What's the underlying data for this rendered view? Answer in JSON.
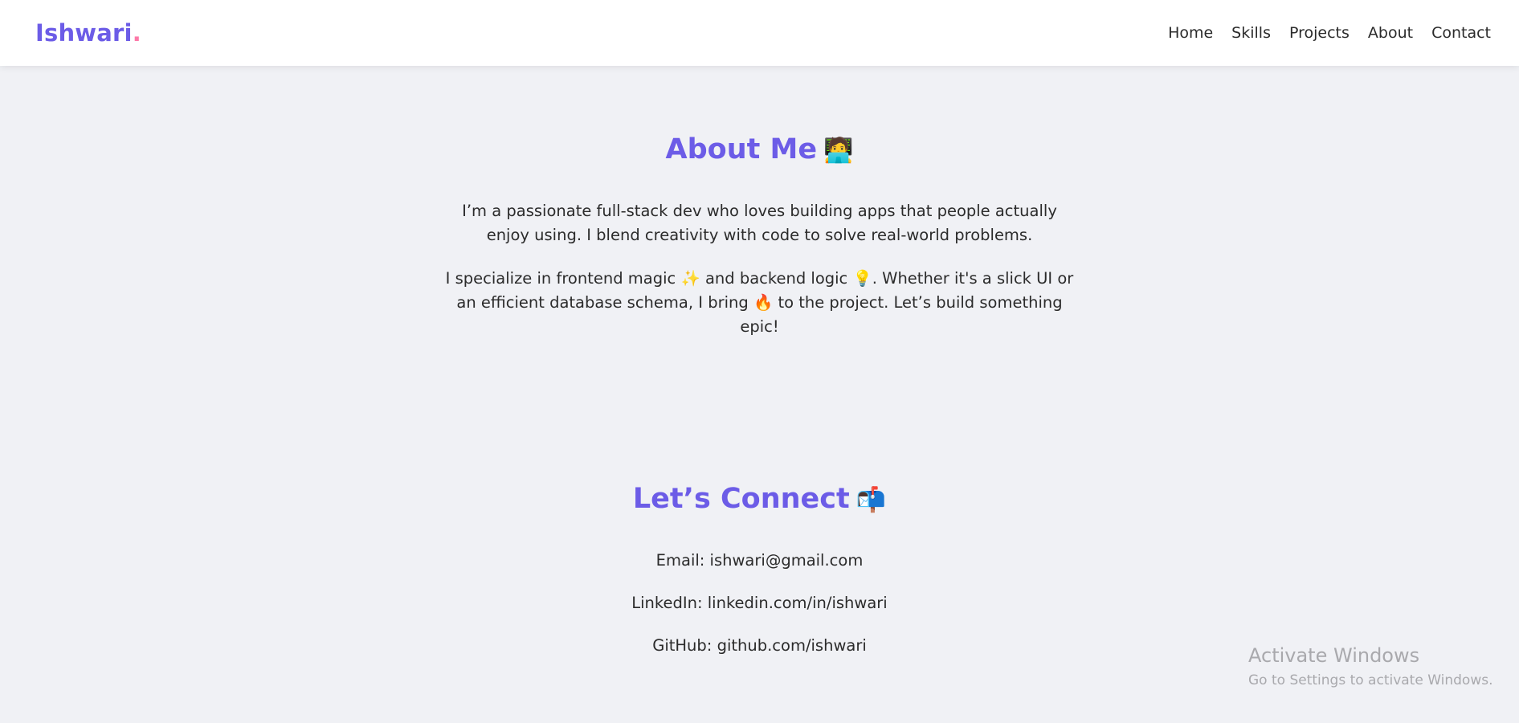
{
  "nav": {
    "logo": "Ishwari",
    "logo_dot": ".",
    "links": [
      "Home",
      "Skills",
      "Projects",
      "About",
      "Contact"
    ]
  },
  "about": {
    "title": "About Me",
    "title_emoji": "🧑‍💻",
    "p1": "I’m a passionate full-stack dev who loves building apps that people actually enjoy using. I blend creativity with code to solve real-world problems.",
    "p2_a": "I specialize in frontend magic",
    "p2_emoji1": "✨",
    "p2_b": "and backend logic",
    "p2_emoji2": "💡",
    "p2_c": ". Whether it's a slick UI or an efficient database schema, I bring",
    "p2_emoji3": "🔥",
    "p2_d": "to the project. Let’s build something epic!"
  },
  "contact": {
    "title": "Let’s Connect",
    "title_emoji": "📬",
    "email_label": "Email:",
    "email": "ishwari@gmail.com",
    "linkedin_label": "LinkedIn:",
    "linkedin": "linkedin.com/in/ishwari",
    "github_label": "GitHub:",
    "github": "github.com/ishwari"
  },
  "watermark": {
    "title": "Activate Windows",
    "subtitle": "Go to Settings to activate Windows."
  },
  "colors": {
    "accent": "#6c5ce7",
    "logo_dot": "#fd79a8",
    "background": "#f0f1f5",
    "text": "#2b2b2b"
  }
}
